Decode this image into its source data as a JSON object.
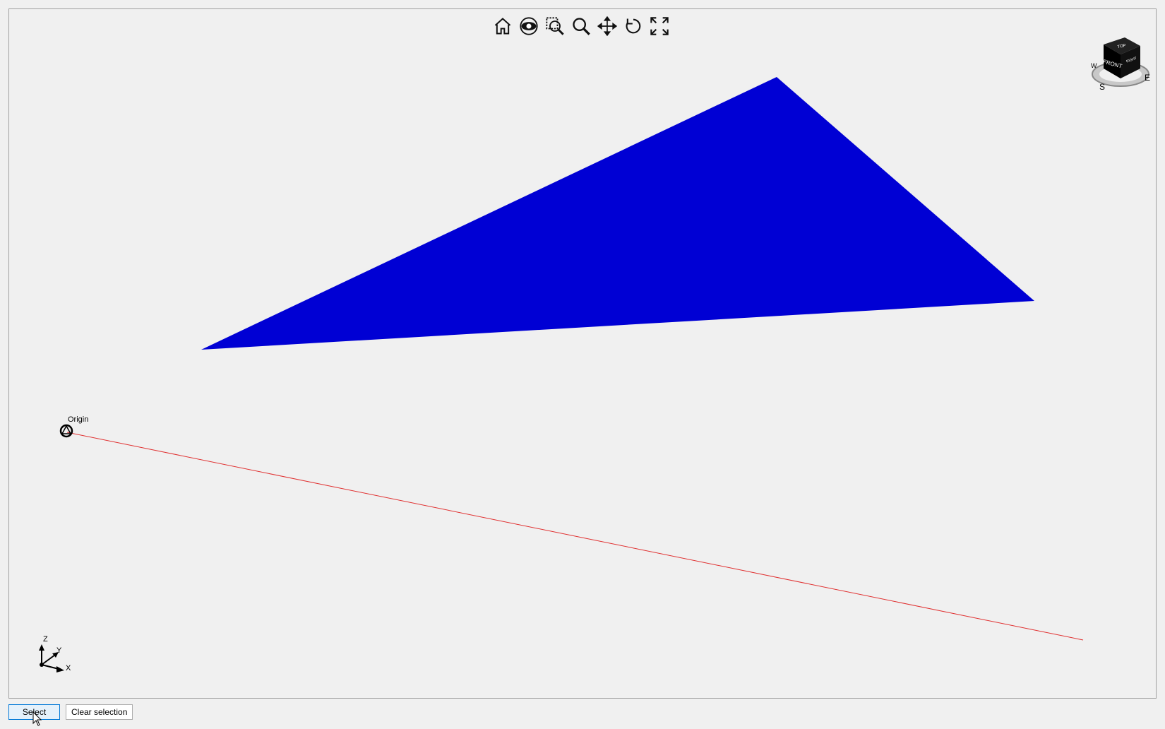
{
  "toolbar": {
    "items": [
      {
        "icon": "home-icon"
      },
      {
        "icon": "eye-icon"
      },
      {
        "icon": "zoom-window-icon"
      },
      {
        "icon": "zoom-icon"
      },
      {
        "icon": "pan-icon"
      },
      {
        "icon": "rotate-icon"
      },
      {
        "icon": "fullscreen-icon"
      }
    ]
  },
  "scene": {
    "triangle_color": "#0000d4",
    "line_color": "#e03030",
    "origin_label": "Origin"
  },
  "axes": {
    "z": "Z",
    "y": "Y",
    "x": "X"
  },
  "navcube": {
    "top": "TOP",
    "front": "FRONT",
    "right": "RIGHT",
    "w": "W",
    "s": "S",
    "e": "E"
  },
  "buttons": {
    "select": "Select",
    "clear": "Clear selection"
  },
  "colors": {
    "background": "#f0f0f0",
    "select_bg": "#e5f1fb",
    "select_border": "#0078d7"
  }
}
